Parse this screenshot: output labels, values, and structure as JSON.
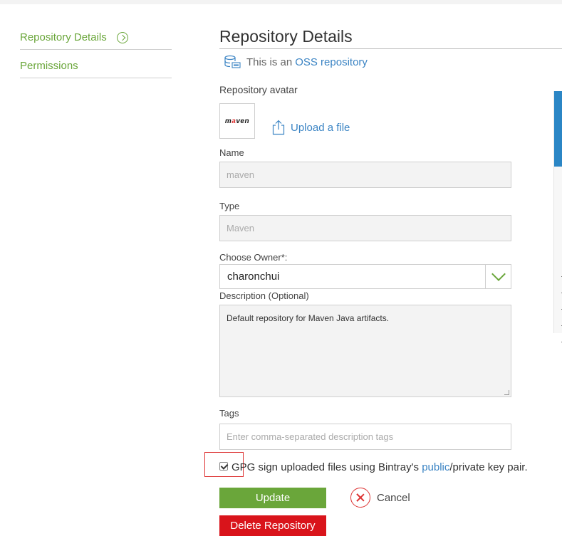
{
  "sidebar": {
    "items": [
      {
        "label": "Repository Details",
        "active": true
      },
      {
        "label": "Permissions",
        "active": false
      }
    ]
  },
  "main": {
    "title": "Repository Details",
    "oss_prefix": "This is an",
    "oss_link": "OSS repository",
    "avatar_label": "Repository avatar",
    "avatar_logo": {
      "pre": "m",
      "accent": "a",
      "post": "ven"
    },
    "upload_label": "Upload a file",
    "name_label": "Name",
    "name_value": "maven",
    "type_label": "Type",
    "type_value": "Maven",
    "owner_label": "Choose Owner*:",
    "owner_value": "charonchui",
    "description_label": "Description (Optional)",
    "description_value": "Default repository for Maven Java artifacts.",
    "tags_label": "Tags",
    "tags_placeholder": "Enter comma-separated description tags",
    "gpg": {
      "checked": true,
      "text_before": "GPG sign uploaded files using Bintray's ",
      "link": "public",
      "text_after": "/private key pair."
    },
    "update_label": "Update",
    "cancel_label": "Cancel",
    "delete_label": "Delete Repository"
  },
  "colors": {
    "accent_green": "#6aa63a",
    "link_blue": "#3b84c4",
    "danger_red": "#d9141b"
  }
}
